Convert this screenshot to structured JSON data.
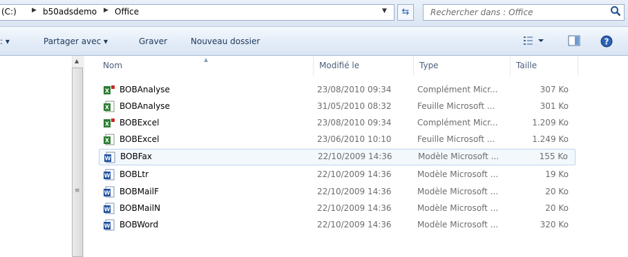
{
  "address": {
    "crumbs": [
      "(C:)",
      "b50adsdemo",
      "Office"
    ],
    "search_placeholder": "Rechercher dans : Office"
  },
  "toolbar": {
    "share_label": "Partager avec ▾",
    "burn_label": "Graver",
    "new_folder_label": "Nouveau dossier"
  },
  "columns": {
    "name": "Nom",
    "modified": "Modifié le",
    "type": "Type",
    "size": "Taille"
  },
  "files": [
    {
      "name": "BOBAnalyse",
      "modified": "23/08/2010 09:34",
      "type": "Complément Micr...",
      "size": "307 Ko",
      "icon": "excel-addin-icon"
    },
    {
      "name": "BOBAnalyse",
      "modified": "31/05/2010 08:32",
      "type": "Feuille Microsoft ...",
      "size": "301 Ko",
      "icon": "excel-sheet-icon"
    },
    {
      "name": "BOBExcel",
      "modified": "23/08/2010 09:34",
      "type": "Complément Micr...",
      "size": "1.209 Ko",
      "icon": "excel-addin-icon"
    },
    {
      "name": "BOBExcel",
      "modified": "23/06/2010 10:10",
      "type": "Feuille Microsoft ...",
      "size": "1.249 Ko",
      "icon": "excel-sheet-icon"
    },
    {
      "name": "BOBFax",
      "modified": "22/10/2009 14:36",
      "type": "Modèle Microsoft ...",
      "size": "155 Ko",
      "icon": "word-template-icon",
      "selected": true
    },
    {
      "name": "BOBLtr",
      "modified": "22/10/2009 14:36",
      "type": "Modèle Microsoft ...",
      "size": "19 Ko",
      "icon": "word-template-icon"
    },
    {
      "name": "BOBMailF",
      "modified": "22/10/2009 14:36",
      "type": "Modèle Microsoft ...",
      "size": "20 Ko",
      "icon": "word-template-icon"
    },
    {
      "name": "BOBMailN",
      "modified": "22/10/2009 14:36",
      "type": "Modèle Microsoft ...",
      "size": "20 Ko",
      "icon": "word-template-icon"
    },
    {
      "name": "BOBWord",
      "modified": "22/10/2009 14:36",
      "type": "Modèle Microsoft ...",
      "size": "320 Ko",
      "icon": "word-template-icon"
    }
  ]
}
